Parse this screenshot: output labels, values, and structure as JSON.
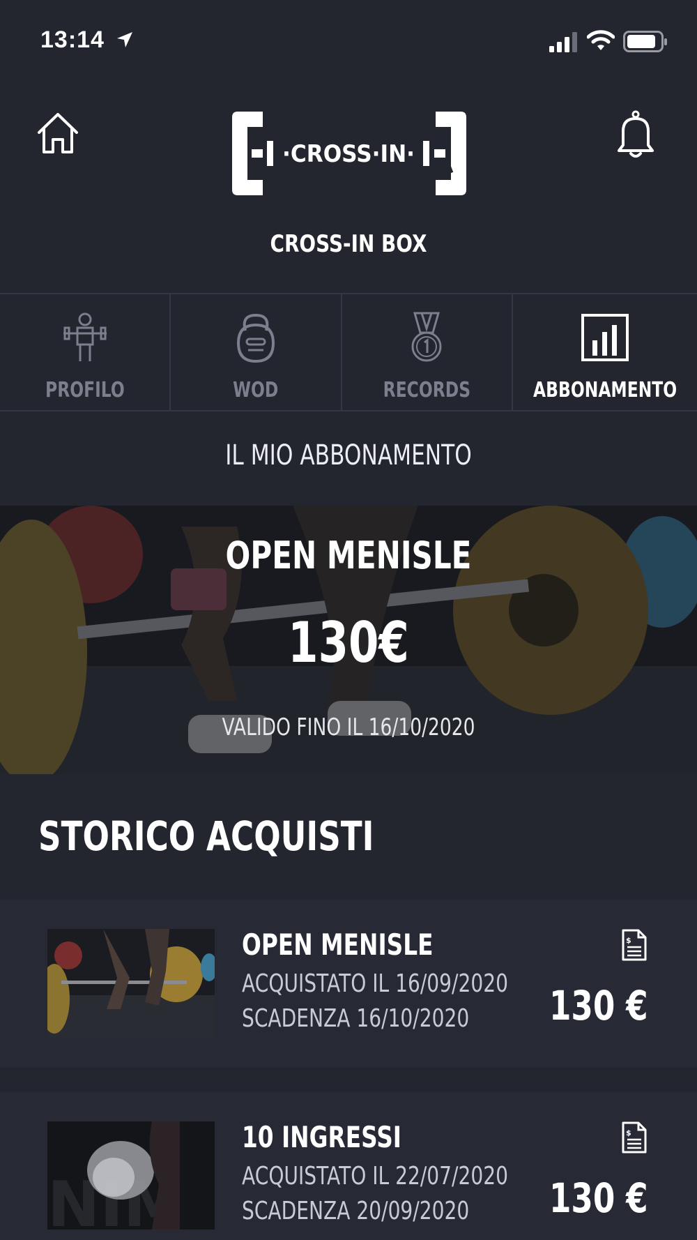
{
  "status_bar": {
    "time": "13:14"
  },
  "header": {
    "logo_text": "CROSS·IN",
    "box_name": "CROSS-IN BOX"
  },
  "tabs": [
    {
      "label": "PROFILO",
      "icon": "weightlifter-icon",
      "active": false
    },
    {
      "label": "WOD",
      "icon": "kettlebell-icon",
      "active": false
    },
    {
      "label": "RECORDS",
      "icon": "medal-icon",
      "active": false
    },
    {
      "label": "ABBONAMENTO",
      "icon": "bar-chart-icon",
      "active": true
    }
  ],
  "section_title": "IL MIO ABBONAMENTO",
  "current_subscription": {
    "name": "OPEN MENISLE",
    "price": "130€",
    "valid_until": "VALIDO FINO IL 16/10/2020"
  },
  "history": {
    "title": "STORICO ACQUISTI",
    "items": [
      {
        "name": "OPEN MENISLE",
        "purchased": "ACQUISTATO IL 16/09/2020",
        "expires": "SCADENZA 16/10/2020",
        "price": "130 €"
      },
      {
        "name": "10 INGRESSI",
        "purchased": "ACQUISTATO IL 22/07/2020",
        "expires": "SCADENZA 20/09/2020",
        "price": "130 €"
      }
    ]
  },
  "colors": {
    "background": "#23252f",
    "card": "#272a35",
    "divider": "#343744",
    "inactive_tab": "#7c7f8e",
    "active_tab": "#ffffff"
  }
}
